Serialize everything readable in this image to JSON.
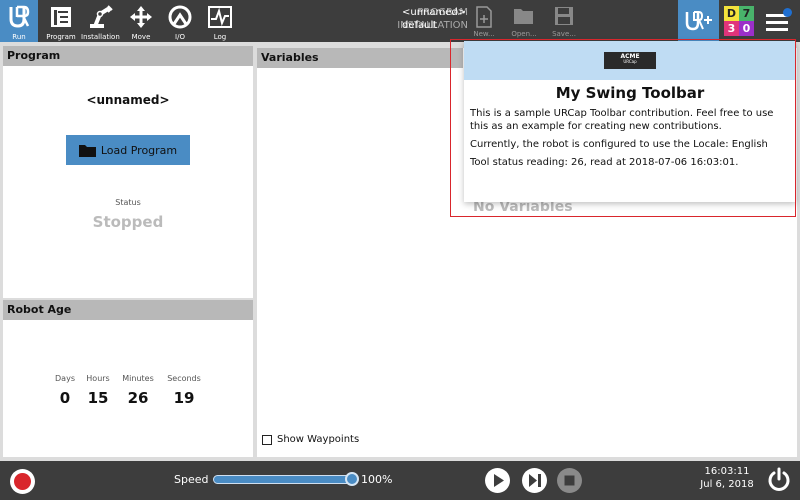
{
  "topbar": {
    "nav": [
      {
        "label": "Run",
        "icon": "ur-logo-icon"
      },
      {
        "label": "Program",
        "icon": "program-icon"
      },
      {
        "label": "Installation",
        "icon": "robot-arm-icon"
      },
      {
        "label": "Move",
        "icon": "move-arrows-icon"
      },
      {
        "label": "I/O",
        "icon": "io-icon"
      },
      {
        "label": "Log",
        "icon": "log-icon"
      }
    ],
    "program_label": "PROGRAM",
    "program_value": "<unnamed>",
    "installation_label": "INSTALLATION",
    "installation_value": "default",
    "file": [
      {
        "label": "New...",
        "icon": "new-file-icon"
      },
      {
        "label": "Open...",
        "icon": "open-folder-icon"
      },
      {
        "label": "Save...",
        "icon": "save-icon"
      }
    ],
    "urplus_icon": "urcap-plus-icon",
    "status_grid": [
      {
        "text": "D",
        "bg": "#f4e23c",
        "fg": "#222222"
      },
      {
        "text": "7",
        "bg": "#49b36b",
        "fg": "#222222"
      },
      {
        "text": "3",
        "bg": "#e0347a",
        "fg": "#ffffff"
      },
      {
        "text": "0",
        "bg": "#9b2fc9",
        "fg": "#ffffff"
      }
    ]
  },
  "program_panel": {
    "title": "Program",
    "name": "<unnamed>",
    "load_button": "Load Program",
    "status_label": "Status",
    "status_value": "Stopped"
  },
  "robot_age": {
    "title": "Robot Age",
    "columns": [
      {
        "label": "Days",
        "value": "0"
      },
      {
        "label": "Hours",
        "value": "15"
      },
      {
        "label": "Minutes",
        "value": "26"
      },
      {
        "label": "Seconds",
        "value": "19"
      }
    ]
  },
  "variables": {
    "title": "Variables",
    "empty_text": "No Variables",
    "show_waypoints": "Show Waypoints"
  },
  "popup": {
    "logo_text": "ACME",
    "logo_sub": "URCap",
    "title": "My Swing Toolbar",
    "para1": "This is a sample URCap Toolbar contribution. Feel free to use this as an example for creating new contributions.",
    "para2": "Currently, the robot is configured to use the Locale: English",
    "para3": "Tool status reading: 26, read at 2018-07-06 16:03:01."
  },
  "bottombar": {
    "speed_label": "Speed",
    "speed_value": "100%",
    "speed_fraction": 1.0,
    "time": "16:03:11",
    "date": "Jul 6, 2018"
  },
  "colors": {
    "accent": "#4a8cc4",
    "highlight": "#d9262c",
    "bar": "#3d3d3d"
  }
}
